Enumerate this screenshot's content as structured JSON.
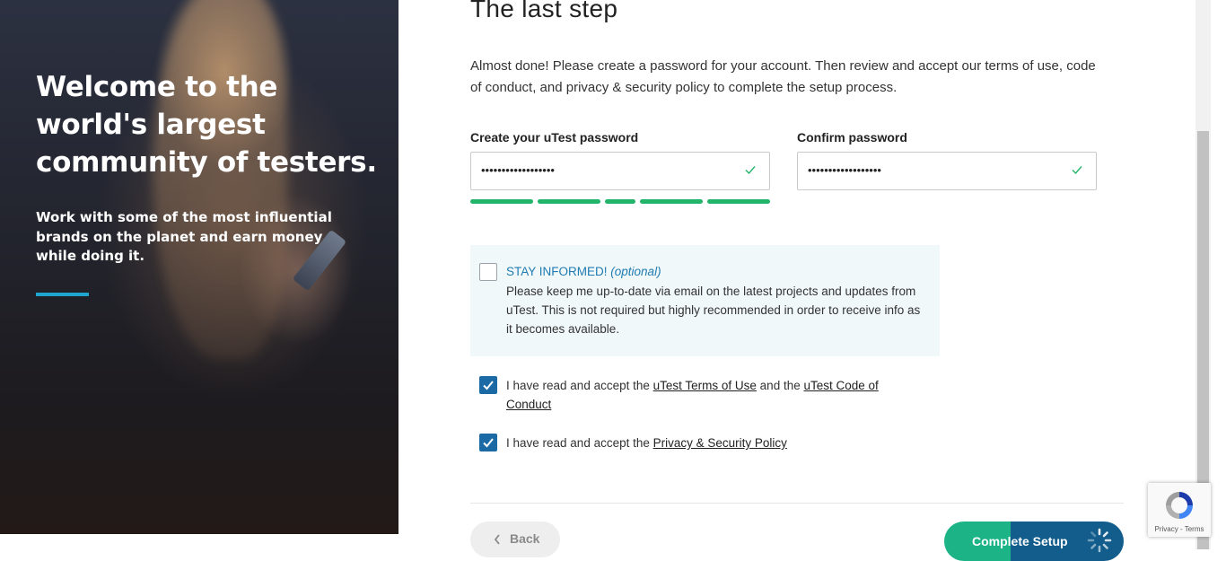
{
  "hero": {
    "title": "Welcome to the world's largest community of testers.",
    "subtitle": "Work with some of the most influential brands on the planet and earn money while doing it.",
    "accent_color": "#1fa6cf"
  },
  "page": {
    "title": "The last step",
    "intro": "Almost done! Please create a password for your account. Then review and accept our terms of use, code of conduct, and privacy & security policy to complete the setup process."
  },
  "password": {
    "label": "Create your uTest password",
    "value": "••••••••••••••••••",
    "valid": true,
    "strength_segments": 5,
    "strength_filled": 5,
    "strength_color": "#21b46a"
  },
  "confirm": {
    "label": "Confirm password",
    "value": "••••••••••••••••••",
    "valid": true
  },
  "stay_informed": {
    "title": "STAY INFORMED!",
    "note": "(optional)",
    "text": "Please keep me up-to-date via email on the latest projects and updates from uTest. This is not required but highly recommended in order to receive info as it becomes available.",
    "checked": false
  },
  "terms": {
    "prefix": "I have read and accept the ",
    "link1": "uTest Terms of Use",
    "middle": " and the ",
    "link2": "uTest Code of Conduct",
    "checked": true
  },
  "privacy": {
    "prefix": "I have read and accept the ",
    "link": "Privacy & Security Policy",
    "checked": true
  },
  "buttons": {
    "back": "Back",
    "complete": "Complete Setup"
  },
  "recaptcha": {
    "links": "Privacy - Terms"
  },
  "colors": {
    "checkbox_checked": "#1b6aa6",
    "primary_green": "#1cb487",
    "primary_blue": "#125d8c",
    "link_blue": "#1f7bb1"
  }
}
